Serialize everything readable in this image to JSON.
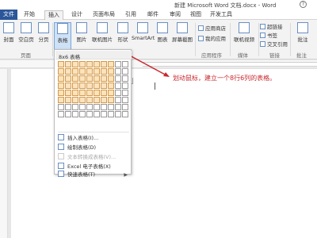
{
  "window": {
    "title": "新建 Microsoft Word 文档.docx - Word",
    "help": "?"
  },
  "tabs": [
    {
      "label": "文件"
    },
    {
      "label": "开始"
    },
    {
      "label": "插入"
    },
    {
      "label": "设计"
    },
    {
      "label": "页面布局"
    },
    {
      "label": "引用"
    },
    {
      "label": "邮件"
    },
    {
      "label": "审阅"
    },
    {
      "label": "视图"
    },
    {
      "label": "开发工具"
    }
  ],
  "ribbon": {
    "cover": "封面",
    "blank_page": "空白页",
    "page_break": "分页",
    "table": "表格",
    "pictures": "图片",
    "online_pictures": "联机图片",
    "shapes": "形状",
    "smartart": "SmartArt",
    "chart": "图表",
    "screenshot": "屏幕截图",
    "app_store": "应用商店",
    "my_apps": "我的应用",
    "online_video": "联机视频",
    "hyperlink": "超链接",
    "bookmark": "书签",
    "cross_ref": "交叉引用",
    "comment": "批注",
    "groups": {
      "pages": "页面",
      "apps": "应用程序",
      "media": "媒体",
      "links": "链接",
      "comments": "批注"
    }
  },
  "dropdown": {
    "header": "8x6 表格",
    "grid": {
      "cols": 10,
      "rows": 8,
      "highlight_cols": 8,
      "highlight_rows": 6
    },
    "items": {
      "insert_table": "插入表格(I)...",
      "draw_table": "绘制表格(D)",
      "text_to_table": "文本转换成表格(V)...",
      "excel_table": "Excel 电子表格(X)",
      "quick_tables": "快速表格(T)"
    }
  },
  "annotation": "划动鼠标，建立一个8行6列的表格。",
  "colors": {
    "accent": "#2b579a",
    "highlight": "#fbe3bd",
    "annotation": "#c8282e"
  }
}
